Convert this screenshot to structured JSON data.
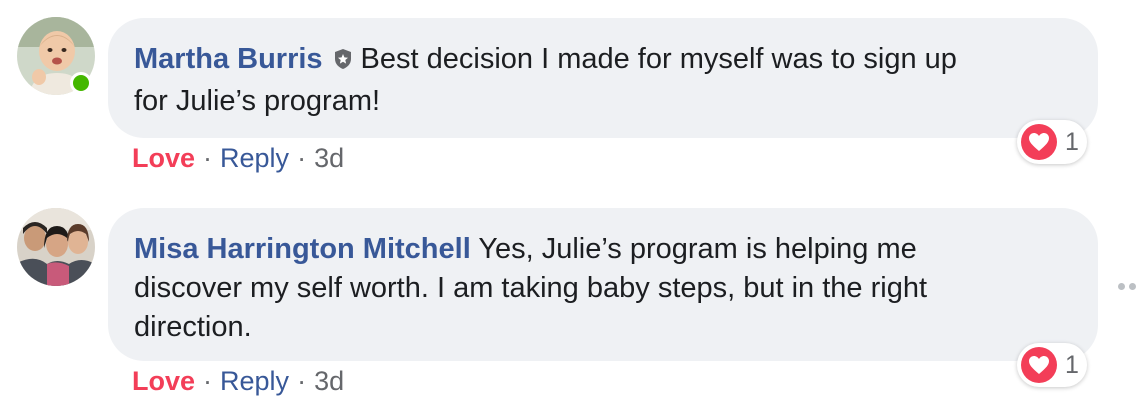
{
  "comments": [
    {
      "author": "Martha Burris",
      "has_badge": true,
      "text_line1": "Best decision I made for myself was to sign up",
      "text_line2": "for Julie’s program!",
      "reaction_count": "1",
      "actions": {
        "love": "Love",
        "reply": "Reply",
        "time": "3d"
      }
    },
    {
      "author": "Misa Harrington Mitchell",
      "text_line1": "Yes, Julie’s program is helping me",
      "text_line2": "discover my self worth. I am taking baby steps, but in the right",
      "text_line3": "direction.",
      "reaction_count": "1",
      "actions": {
        "love": "Love",
        "reply": "Reply",
        "time": "3d"
      }
    }
  ],
  "separator": "·",
  "colors": {
    "author": "#385898",
    "love": "#f33e58",
    "bubble": "#eff1f4",
    "online": "#44b700"
  }
}
